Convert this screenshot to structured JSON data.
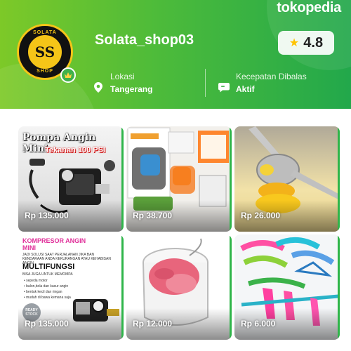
{
  "brand": "tokopedia",
  "shop": {
    "name": "Solata_shop03",
    "logo_text": "SS",
    "logo_ring_top": "SOLATA",
    "logo_ring_bottom": "SHOP",
    "rating": "4.8",
    "location_label": "Lokasi",
    "location_value": "Tangerang",
    "speed_label": "Kecepatan Dibalas",
    "speed_value": "Aktif"
  },
  "products": [
    {
      "price": "Rp 135.000",
      "title": "Pompa Angin Mini",
      "subtitle": "Tekanan 100 PSI",
      "icon": "air-pump-image"
    },
    {
      "price": "Rp 38.700",
      "title": "",
      "subtitle": "",
      "icon": "vegetable-slicer-image"
    },
    {
      "price": "Rp 26.000",
      "title": "",
      "subtitle": "",
      "icon": "lemon-squeezer-image"
    },
    {
      "price": "Rp 135.000",
      "title": "KOMPRESOR ANGIN MINI",
      "subtitle": "MULTIFUNGSI",
      "icon": "air-compressor-image",
      "line1": "JADI SOLUSI SAAT PERJALANAN JIKA BAN KENDARAAN ANDA KEKURANGAN ATAU KEHABISAN ANGIN",
      "line2": "BISA JUGA UNTUK MEMOMPA",
      "bullets": [
        "sepeda motor",
        "balon,bola dan kasur angin",
        "bentuk kecil dan ringan",
        "mudah di bawa kemana saja"
      ],
      "stamp": "READY STOCK"
    },
    {
      "price": "Rp 12.000",
      "title": "",
      "subtitle": "",
      "icon": "laundry-bag-image"
    },
    {
      "price": "Rp 6.000",
      "title": "",
      "subtitle": "",
      "icon": "clothes-hanger-image"
    }
  ],
  "colors": {
    "header_start": "#7dc928",
    "header_end": "#22a84b",
    "accent": "#2fb54a",
    "star": "#ffc400"
  }
}
